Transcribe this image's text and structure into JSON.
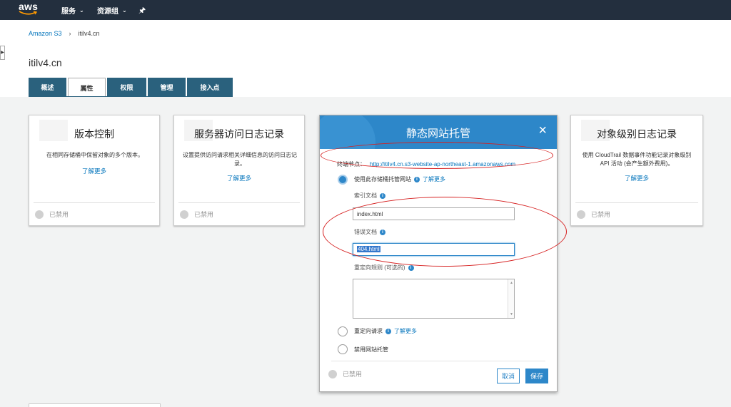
{
  "topnav": {
    "logo": "aws",
    "services": "服务",
    "resource_groups": "资源组"
  },
  "breadcrumb": {
    "root": "Amazon S3",
    "separator": "›",
    "current": "itilv4.cn"
  },
  "bucket_title": "itilv4.cn",
  "tabs": [
    {
      "label": "概述",
      "active": false
    },
    {
      "label": "属性",
      "active": true
    },
    {
      "label": "权限",
      "active": false
    },
    {
      "label": "管理",
      "active": false
    },
    {
      "label": "接入点",
      "active": false
    }
  ],
  "cards": {
    "versioning": {
      "title": "版本控制",
      "desc": "在相同存储桶中保留对象的多个版本。",
      "more": "了解更多",
      "status": "已禁用"
    },
    "access_log": {
      "title": "服务器访问日志记录",
      "desc": "设置提供访问请求相关详细信息的访问日志记录。",
      "more": "了解更多",
      "status": "已禁用"
    },
    "object_log": {
      "title": "对象级别日志记录",
      "desc": "使用 CloudTrail 数据事件功能记录对象级别 API 活动 (会产生额外费用)。",
      "more": "了解更多",
      "status": "已禁用"
    }
  },
  "modal": {
    "title": "静态网站托管",
    "close": "×",
    "endpoint_label": "终端节点：",
    "endpoint_url": "http://itilv4.cn.s3-website-ap-northeast-1.amazonaws.com",
    "option_host": "使用此存储桶托管网站",
    "learn_more": "了解更多",
    "index_label": "索引文档",
    "index_value": "index.html",
    "error_label": "错误文档",
    "error_value": "404.html",
    "redirect_rules_label": "重定向规则 (可选的)",
    "option_redirect": "重定向请求",
    "option_disable": "禁用网站托管",
    "status": "已禁用",
    "cancel": "取消",
    "save": "保存"
  },
  "colors": {
    "nav_bg": "#232f3e",
    "tab_bg": "#2a617d",
    "modal_header": "#2d87c9",
    "link": "#0073bb",
    "annotation": "#d62020"
  }
}
